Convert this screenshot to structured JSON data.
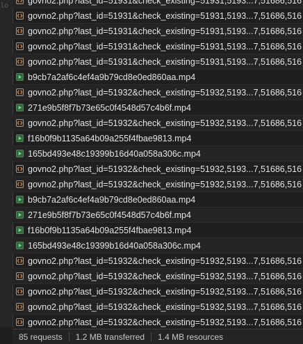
{
  "gutter": {
    "label": "lo"
  },
  "requests": [
    {
      "type": "xhr",
      "name": "govno2.php?last_id=51931&check_existing=51931,5193...7,51686,516"
    },
    {
      "type": "xhr",
      "name": "govno2.php?last_id=51931&check_existing=51931,5193...7,51686,516"
    },
    {
      "type": "xhr",
      "name": "govno2.php?last_id=51931&check_existing=51931,5193...7,51686,516"
    },
    {
      "type": "xhr",
      "name": "govno2.php?last_id=51931&check_existing=51931,5193...7,51686,516"
    },
    {
      "type": "xhr",
      "name": "govno2.php?last_id=51931&check_existing=51931,5193...7,51686,516"
    },
    {
      "type": "media",
      "name": "b9cb7a2af6c4ef4a9b79cd8e0ed860aa.mp4"
    },
    {
      "type": "xhr",
      "name": "govno2.php?last_id=51932&check_existing=51932,5193...7,51686,516"
    },
    {
      "type": "media",
      "name": "271e9b5f8f7b73e65c0f4548d57c4b6f.mp4"
    },
    {
      "type": "xhr",
      "name": "govno2.php?last_id=51932&check_existing=51932,5193...7,51686,516"
    },
    {
      "type": "media",
      "name": "f16b0f9b1135a64b09a255f4fbae9813.mp4"
    },
    {
      "type": "media",
      "name": "165bd493e48c19399b16d40a058a306c.mp4"
    },
    {
      "type": "xhr",
      "name": "govno2.php?last_id=51932&check_existing=51932,5193...7,51686,516"
    },
    {
      "type": "xhr",
      "name": "govno2.php?last_id=51932&check_existing=51932,5193...7,51686,516"
    },
    {
      "type": "media",
      "name": "b9cb7a2af6c4ef4a9b79cd8e0ed860aa.mp4"
    },
    {
      "type": "media",
      "name": "271e9b5f8f7b73e65c0f4548d57c4b6f.mp4"
    },
    {
      "type": "media",
      "name": "f16b0f9b1135a64b09a255f4fbae9813.mp4"
    },
    {
      "type": "media",
      "name": "165bd493e48c19399b16d40a058a306c.mp4"
    },
    {
      "type": "xhr",
      "name": "govno2.php?last_id=51932&check_existing=51932,5193...7,51686,516"
    },
    {
      "type": "xhr",
      "name": "govno2.php?last_id=51932&check_existing=51932,5193...7,51686,516"
    },
    {
      "type": "xhr",
      "name": "govno2.php?last_id=51932&check_existing=51932,5193...7,51686,516"
    },
    {
      "type": "xhr",
      "name": "govno2.php?last_id=51932&check_existing=51932,5193...7,51686,516"
    },
    {
      "type": "xhr",
      "name": "govno2.php?last_id=51932&check_existing=51932,5193...7,51686,516"
    },
    {
      "type": "xhr",
      "name": "govno2.php?last_id=51932&check_existing=51932,5193...7,51686,516"
    },
    {
      "type": "xhr",
      "name": "govno2.php?last_id=51932&check_existing=51932,5193...7,51686,516"
    }
  ],
  "status": {
    "requests": "85 requests",
    "transferred": "1.2 MB transferred",
    "resources": "1.4 MB resources"
  },
  "colors": {
    "xhr_icon": "#d98a4a",
    "media_icon": "#2e6b3a",
    "background": "#1f1f1f"
  }
}
